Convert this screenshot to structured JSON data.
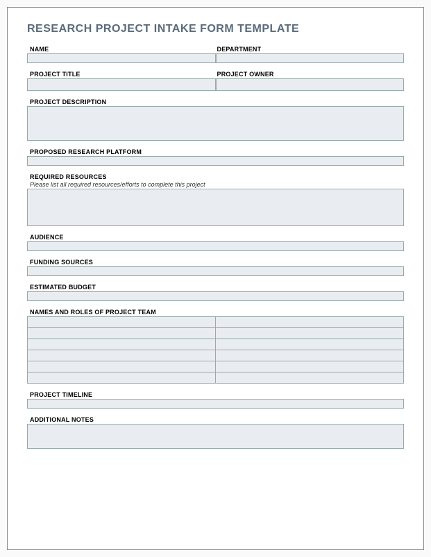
{
  "title": "RESEARCH PROJECT INTAKE FORM TEMPLATE",
  "fields": {
    "name": {
      "label": "NAME",
      "value": ""
    },
    "department": {
      "label": "DEPARTMENT",
      "value": ""
    },
    "projectTitle": {
      "label": "PROJECT TITLE",
      "value": ""
    },
    "projectOwner": {
      "label": "PROJECT OWNER",
      "value": ""
    },
    "projectDescription": {
      "label": "PROJECT DESCRIPTION",
      "value": ""
    },
    "proposedResearchPlatform": {
      "label": "PROPOSED RESEARCH PLATFORM",
      "value": ""
    },
    "requiredResources": {
      "label": "REQUIRED RESOURCES",
      "helper": "Please list all required resources/efforts to complete this project",
      "value": ""
    },
    "audience": {
      "label": "AUDIENCE",
      "value": ""
    },
    "fundingSources": {
      "label": "FUNDING SOURCES",
      "value": ""
    },
    "estimatedBudget": {
      "label": "ESTIMATED BUDGET",
      "value": ""
    },
    "teamHeader": {
      "label": "NAMES AND ROLES OF PROJECT TEAM"
    },
    "teamRows": [
      {
        "name": "",
        "role": ""
      },
      {
        "name": "",
        "role": ""
      },
      {
        "name": "",
        "role": ""
      },
      {
        "name": "",
        "role": ""
      },
      {
        "name": "",
        "role": ""
      },
      {
        "name": "",
        "role": ""
      }
    ],
    "projectTimeline": {
      "label": "PROJECT TIMELINE",
      "value": ""
    },
    "additionalNotes": {
      "label": "ADDITIONAL NOTES",
      "value": ""
    }
  }
}
